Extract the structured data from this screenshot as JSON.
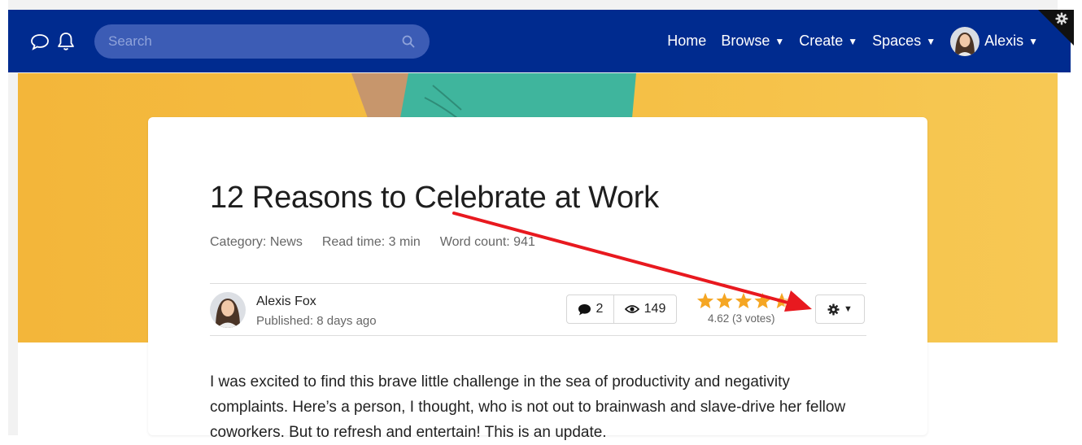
{
  "header": {
    "search": {
      "placeholder": "Search",
      "value": ""
    },
    "nav": [
      {
        "label": "Home",
        "has_caret": false
      },
      {
        "label": "Browse",
        "has_caret": true
      },
      {
        "label": "Create",
        "has_caret": true
      },
      {
        "label": "Spaces",
        "has_caret": true
      }
    ],
    "user": {
      "name": "Alexis"
    }
  },
  "article": {
    "title": "12 Reasons to Celebrate at Work",
    "meta": {
      "category": "Category: News",
      "read_time": "Read time: 3 min",
      "word_count": "Word count: 941"
    },
    "author": {
      "name": "Alexis Fox",
      "published": "Published: 8 days ago"
    },
    "stats": {
      "comments": "2",
      "views": "149"
    },
    "rating": {
      "value": 4.62,
      "max": 5,
      "text": "4.62 (3 votes)"
    },
    "body": "I was excited to find this brave little challenge in the sea of productivity and negativity complaints. Here’s a person, I thought, who is not out to brainwash and slave-drive her fellow coworkers. But to refresh and entertain! This is an update."
  },
  "colors": {
    "navbar": "#002b8f",
    "hero": "#f5be44",
    "star": "#f5a623",
    "annotation_arrow": "#e8191f"
  },
  "icons": {
    "chat": "speech-bubble-icon",
    "notifications": "bell-icon",
    "search": "magnifier-icon",
    "admin": "gear-icon",
    "comments": "comment-icon",
    "views": "eye-icon",
    "actions": "gear-icon"
  }
}
